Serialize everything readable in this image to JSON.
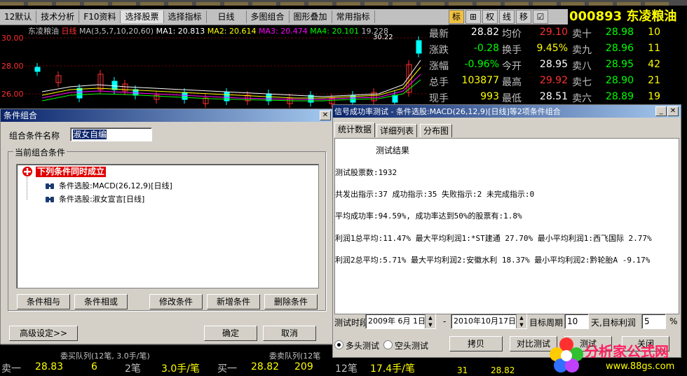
{
  "toolbar": {
    "items": [
      "12默认",
      "技术分析",
      "F10资料",
      "选择股票",
      "选择指标",
      "日线",
      "多图组合",
      "图形叠加",
      "常用指标"
    ],
    "active_index": 3,
    "right_icons": [
      "标",
      "⊞",
      "权",
      "线",
      "移",
      "☑"
    ]
  },
  "stock": {
    "code": "000893",
    "name": "东凌粮油"
  },
  "chart": {
    "name": "东凌粮油",
    "period": "日线",
    "ma_params": "MA(3,5,7,10,20,60)",
    "ma1": "MA1: 20.813",
    "ma2": "MA2: 20.614",
    "ma3": "MA3: 20.474",
    "ma4": "MA4: 20.101",
    "high_label": "19.228",
    "peak_label": "30.22",
    "y_ticks": [
      "30.00",
      "28.00",
      "26.00"
    ]
  },
  "quote": {
    "rows": [
      {
        "l1": "最新",
        "v1": "28.82",
        "l2": "均价",
        "v2": "29.10",
        "l3": "卖十",
        "v3": "28.98",
        "n3": "10",
        "c1": "#ffffff",
        "c2": "#ff3030"
      },
      {
        "l1": "涨跌",
        "v1": "-0.28",
        "l2": "换手",
        "v2": "9.45%",
        "l3": "卖九",
        "v3": "28.96",
        "n3": "11",
        "c1": "#00ff00",
        "c2": "#ffff00"
      },
      {
        "l1": "涨幅",
        "v1": "-0.96%",
        "l2": "今开",
        "v2": "28.95",
        "l3": "卖八",
        "v3": "28.95",
        "n3": "42",
        "c1": "#00ff00",
        "c2": "#ffffff"
      },
      {
        "l1": "总手",
        "v1": "103877",
        "l2": "最高",
        "v2": "29.92",
        "l3": "卖七",
        "v3": "28.90",
        "n3": "21",
        "c1": "#ffff00",
        "c2": "#ff3030"
      },
      {
        "l1": "现手",
        "v1": "993",
        "l2": "最低",
        "v2": "28.51",
        "l3": "卖六",
        "v3": "28.89",
        "n3": "19",
        "c1": "#ffff00",
        "c2": "#ffffff"
      }
    ]
  },
  "bottom": {
    "text1": "委买队列(12笔, 3.0手/笔)",
    "text2": "委卖队列(12笔",
    "row": [
      "卖一",
      "28.83",
      "6",
      "2笔",
      "3.0手/笔",
      "买一",
      "28.82",
      "209",
      "12笔",
      "17.4手/笔",
      "31",
      "28.82"
    ]
  },
  "dialog1": {
    "title": "条件组合",
    "name_label": "组合条件名称",
    "name_value": "淑女自编",
    "group_label": "当前组合条件",
    "root": "下列条件同时成立",
    "children": [
      "条件选股:MACD(26,12,9)[日线]",
      "条件选股:淑女宣言[日线]"
    ],
    "buttons": [
      "条件相与",
      "条件相或",
      "修改条件",
      "新增条件",
      "删除条件"
    ],
    "advanced": "高级设定>>",
    "ok": "确定",
    "cancel": "取消"
  },
  "dialog2": {
    "title": "信号成功率测试 - 条件选股:MACD(26,12,9)[日线]等2项条件组合",
    "tabs": [
      "统计数据",
      "详细列表",
      "分布图"
    ],
    "heading": "测试结果",
    "lines": [
      "测试股票数:1932",
      "共发出指示:37 成功指示:35 失败指示:2 未完成指示:0",
      "平均成功率:94.59%, 成功率达到50%的股票有:1.8%",
      "利润1总平均:11.47% 最大平均利润1:*ST建通  27.70% 最小平均利润1:西飞国际 2.77%",
      "利润2总平均:5.71% 最大平均利润2:安徽水利 18.37% 最小平均利润2:黔轮胎A  -9.17%"
    ],
    "period_label": "测试时段",
    "date_from": "2009年 6月 1日",
    "dash": "-",
    "date_to": "2010年10月17日",
    "target_period_label": "目标周期",
    "target_period": "10",
    "target_profit_label": "天,目标利润",
    "target_profit": "5",
    "percent": "%",
    "radio1": "多头测试",
    "radio2": "空头测试",
    "btn1": "拷贝",
    "btn2": "对比测试",
    "btn3": "测试",
    "btn4": "关闭"
  },
  "watermark": {
    "brand": "分析家公式网",
    "url": "www.88gs.com"
  }
}
